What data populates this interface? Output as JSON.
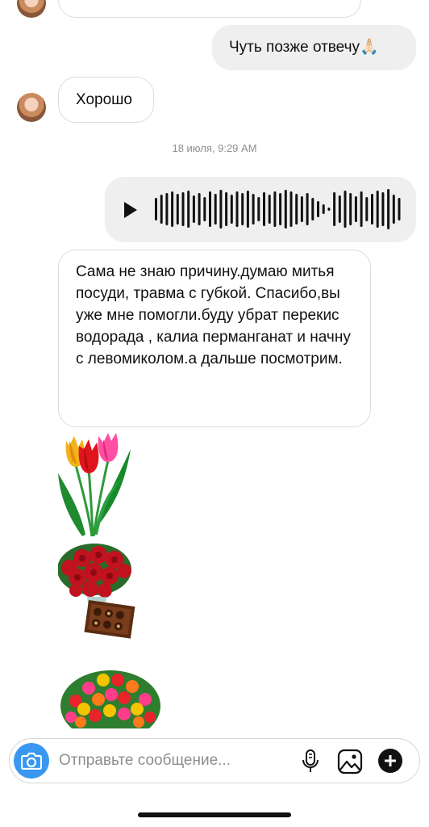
{
  "messages": {
    "previous_incoming": "...",
    "outgoing_1": "Чуть позже отвечу🙏🏻",
    "incoming_1": "Хорошо",
    "timestamp": "18 июля, 9:29 AM",
    "incoming_long": "Сама не знаю причину.думаю митья посуди, травма с губкой. Спасибо,вы уже мне помогли.буду убрат перекис водорада , калиа перманганат и начну с левомиколом.а дальше посмотрим."
  },
  "voice_message": {
    "play_icon": "play-icon",
    "waveform_icon": "audio-waveform-icon"
  },
  "stickers": [
    "tulips-sticker",
    "roses-chocolates-sticker",
    "flower-basket-sticker"
  ],
  "composer": {
    "placeholder": "Отправьте сообщение...",
    "camera_icon": "camera-icon",
    "mic_icon": "microphone-icon",
    "gallery_icon": "image-gallery-icon",
    "add_icon": "plus-icon"
  },
  "colors": {
    "accent": "#3897f0",
    "outgoing_bubble": "#efefef",
    "timestamp": "#8e8e8e"
  }
}
